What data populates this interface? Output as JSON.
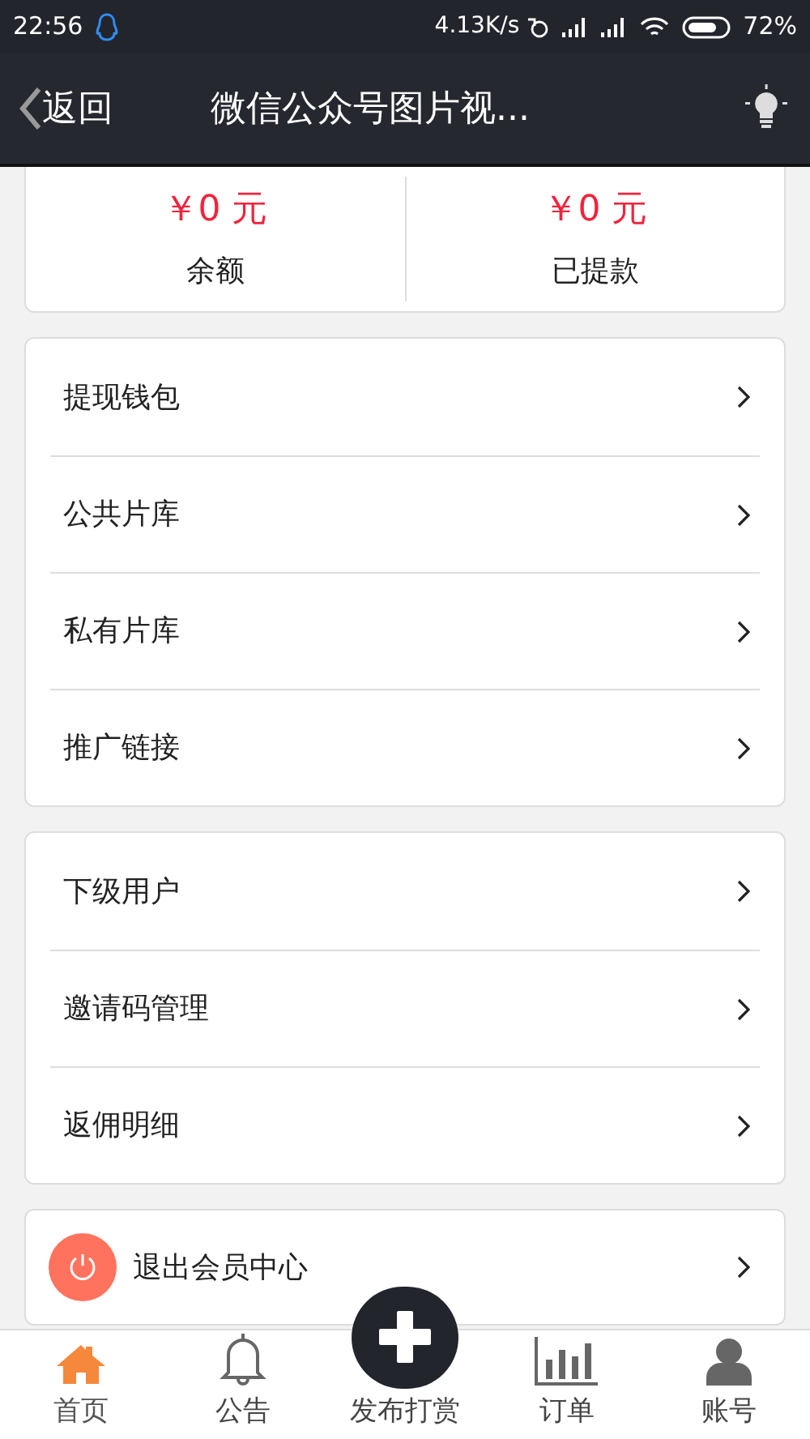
{
  "status_bar": {
    "time": "22:56",
    "speed": "4.13K/s",
    "battery": "72%"
  },
  "header": {
    "back": "返回",
    "title": "微信公众号图片视..."
  },
  "balance": [
    {
      "amount": "￥0 元",
      "label": "余额"
    },
    {
      "amount": "￥0 元",
      "label": "已提款"
    }
  ],
  "menu_groups": [
    [
      {
        "label": "提现钱包"
      },
      {
        "label": "公共片库"
      },
      {
        "label": "私有片库"
      },
      {
        "label": "推广链接"
      }
    ],
    [
      {
        "label": "下级用户"
      },
      {
        "label": "邀请码管理"
      },
      {
        "label": "返佣明细"
      }
    ]
  ],
  "logout": {
    "label": "退出会员中心"
  },
  "bottom_nav": [
    {
      "label": "首页",
      "kind": "home",
      "selected": true
    },
    {
      "label": "公告",
      "kind": "bell",
      "selected": false
    },
    {
      "label": "发布打赏",
      "kind": "publish",
      "selected": false
    },
    {
      "label": "订单",
      "kind": "chart",
      "selected": false
    },
    {
      "label": "账号",
      "kind": "user",
      "selected": false
    }
  ]
}
